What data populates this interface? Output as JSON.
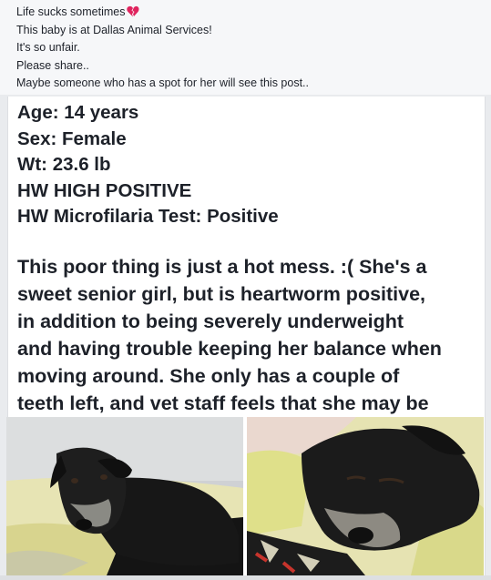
{
  "post": {
    "lines": [
      "Life sucks sometimes",
      "This baby is at Dallas Animal Services!",
      "It's so unfair.",
      "Please share..",
      "Maybe someone who has a spot for her will see this post.."
    ],
    "heart_icon": "broken-heart-icon",
    "heart_color": "#e0245e"
  },
  "image_text": {
    "stats": [
      "Age: 14 years",
      "Sex: Female",
      "Wt: 23.6 lb",
      "HW HIGH POSITIVE",
      "HW Microfilaria Test: Positive"
    ],
    "story": [
      "This poor thing is just a hot mess. :( She's a",
      "sweet senior girl, but is heartworm positive,",
      "in addition to being severely underweight",
      "and having trouble keeping her balance when",
      "moving around. She only has a couple of",
      "teeth left, and vet staff feels that she may be"
    ]
  },
  "photos": [
    {
      "subject": "black senior dog lying on yellow blanket"
    },
    {
      "subject": "close-up of black senior dog resting head on yellow blanket"
    }
  ],
  "colors": {
    "text": "#1d2129",
    "header_bg": "#f6f7f9",
    "card_bg": "#ffffff"
  }
}
